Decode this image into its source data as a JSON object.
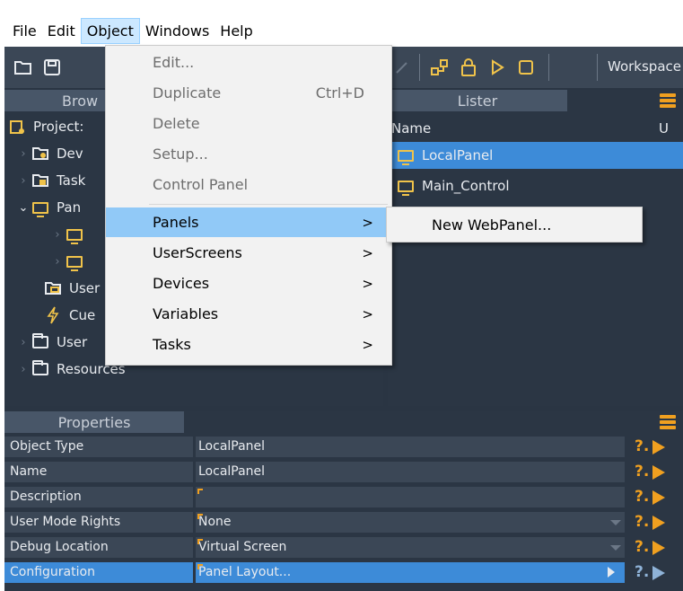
{
  "menubar": {
    "items": [
      "File",
      "Edit",
      "Object",
      "Windows",
      "Help"
    ]
  },
  "toolbar": {
    "workspace_label": "Workspace"
  },
  "browser": {
    "header": "Brow",
    "items": [
      {
        "label": "Project:"
      },
      {
        "label": "Dev"
      },
      {
        "label": "Task"
      },
      {
        "label": "Pan"
      },
      {
        "label": ""
      },
      {
        "label": ""
      },
      {
        "label": "User"
      },
      {
        "label": "Cue"
      },
      {
        "label": "User"
      },
      {
        "label": "Resources"
      }
    ]
  },
  "lister": {
    "header": "Lister",
    "columns": [
      "Name",
      "U"
    ],
    "rows": [
      "LocalPanel",
      "Main_Control"
    ]
  },
  "object_menu": {
    "items": [
      {
        "label": "Edit...",
        "enabled": false
      },
      {
        "label": "Duplicate",
        "enabled": false,
        "shortcut": "Ctrl+D"
      },
      {
        "label": "Delete",
        "enabled": false
      },
      {
        "label": "Setup...",
        "enabled": false
      },
      {
        "label": "Control Panel",
        "enabled": false
      },
      {
        "label": "Panels",
        "enabled": true,
        "submenu": true
      },
      {
        "label": "UserScreens",
        "enabled": true,
        "submenu": true
      },
      {
        "label": "Devices",
        "enabled": true,
        "submenu": true
      },
      {
        "label": "Variables",
        "enabled": true,
        "submenu": true
      },
      {
        "label": "Tasks",
        "enabled": true,
        "submenu": true
      }
    ],
    "submenu_arrow": ">"
  },
  "panels_submenu": {
    "items": [
      "New WebPanel..."
    ]
  },
  "properties": {
    "header": "Properties",
    "rows": [
      {
        "label": "Object Type",
        "value": "LocalPanel"
      },
      {
        "label": "Name",
        "value": "LocalPanel"
      },
      {
        "label": "Description",
        "value": ""
      },
      {
        "label": "User Mode Rights",
        "value": "None"
      },
      {
        "label": "Debug Location",
        "value": "Virtual Screen"
      },
      {
        "label": "Configuration",
        "value": "Panel Layout..."
      }
    ],
    "help_glyph": "?."
  },
  "colors": {
    "accent": "#f0a020",
    "selection": "#3d8bd8",
    "menu_hover": "#91c9f7",
    "panel_bg": "#2b3644"
  }
}
